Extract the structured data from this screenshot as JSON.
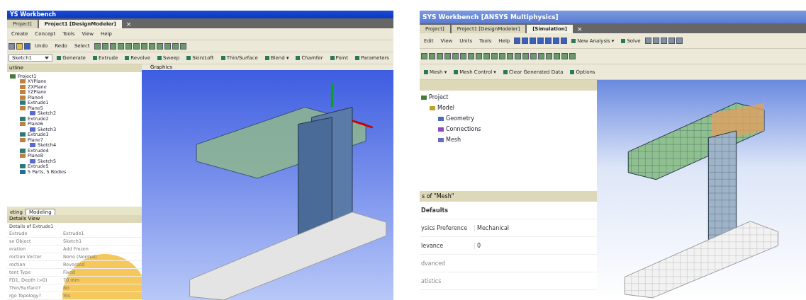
{
  "left_window": {
    "title": "YS Workbench",
    "tabs": [
      {
        "label": "Project]",
        "selected": false
      },
      {
        "label": "Project1 [DesignModeler]",
        "selected": true
      }
    ],
    "tab_close": "×",
    "menu": [
      "Create",
      "Concept",
      "Tools",
      "View",
      "Help"
    ],
    "toolbar": [
      "Undo",
      "Redo",
      "Select"
    ],
    "feature_bar": {
      "sketch_select": "Sketch1",
      "items": [
        "Generate",
        "Extrude",
        "Revolve",
        "Sweep",
        "Skin/Loft",
        "Thin/Surface",
        "Blend ▾",
        "Chamfer",
        "Point",
        "Parameters"
      ]
    },
    "outline": {
      "header": "utline",
      "tree": [
        {
          "label": "Project1",
          "kind": "root",
          "children": [
            {
              "label": "XYPlane",
              "kind": "plane"
            },
            {
              "label": "ZXPlane",
              "kind": "plane"
            },
            {
              "label": "YZPlane",
              "kind": "plane"
            },
            {
              "label": "Plane4",
              "kind": "plane"
            },
            {
              "label": "Extrude1",
              "kind": "extrude"
            },
            {
              "label": "Plane5",
              "kind": "plane",
              "children": [
                {
                  "label": "Sketch2",
                  "kind": "sketch"
                }
              ]
            },
            {
              "label": "Extrude2",
              "kind": "extrude"
            },
            {
              "label": "Plane6",
              "kind": "plane",
              "children": [
                {
                  "label": "Sketch3",
                  "kind": "sketch"
                }
              ]
            },
            {
              "label": "Extrude3",
              "kind": "extrude"
            },
            {
              "label": "Plane7",
              "kind": "plane",
              "children": [
                {
                  "label": "Sketch4",
                  "kind": "sketch"
                }
              ]
            },
            {
              "label": "Extrude4",
              "kind": "extrude"
            },
            {
              "label": "Plane8",
              "kind": "plane",
              "children": [
                {
                  "label": "Sketch5",
                  "kind": "sketch"
                }
              ]
            },
            {
              "label": "Extrude5",
              "kind": "extrude"
            },
            {
              "label": "5 Parts, 5 Bodies",
              "kind": "parts"
            }
          ]
        }
      ]
    },
    "graphics_header": "Graphics",
    "bottom_tabs": [
      {
        "label": "eting",
        "selected": false
      },
      {
        "label": "Modeling",
        "selected": true
      }
    ],
    "details": {
      "header": "Details View",
      "title": "Details of Extrude1",
      "rows": [
        {
          "name": "Extrude",
          "value": "Extrude1"
        },
        {
          "name": "se Object",
          "value": "Sketch1"
        },
        {
          "name": "eration",
          "value": "Add Frozen"
        },
        {
          "name": "rection Vector",
          "value": "None (Normal)"
        },
        {
          "name": "rection",
          "value": "Reversed"
        },
        {
          "name": "tent Type",
          "value": "Fixed"
        },
        {
          "name": "FD1, Depth (>0)",
          "value": "70 mm"
        },
        {
          "name": "Thin/Surface?",
          "value": "No"
        },
        {
          "name": "rge Topology?",
          "value": "Yes"
        }
      ]
    }
  },
  "right_window": {
    "title": "SYS Workbench [ANSYS Multiphysics]",
    "tabs": [
      {
        "label": "Project]",
        "selected": false
      },
      {
        "label": "Project1 [DesignModeler]",
        "selected": false
      },
      {
        "label": "[Simulation]",
        "selected": true
      }
    ],
    "tab_close": "×",
    "menu": [
      "Edit",
      "View",
      "Units",
      "Tools",
      "Help"
    ],
    "toolbar": [
      "New Analysis ▾",
      "Solve"
    ],
    "mesh_bar": [
      "Mesh ▾",
      "Mesh Control ▾",
      "Clear Generated Data",
      "Options"
    ],
    "tree": [
      {
        "label": "Project",
        "kind": "root",
        "children": [
          {
            "label": "Model",
            "kind": "model",
            "children": [
              {
                "label": "Geometry",
                "kind": "geometry"
              },
              {
                "label": "Connections",
                "kind": "connections"
              },
              {
                "label": "Mesh",
                "kind": "mesh"
              }
            ]
          }
        ]
      }
    ],
    "details": {
      "header": "s of \"Mesh\"",
      "rows": [
        {
          "name": "Defaults",
          "kind": "group"
        },
        {
          "name": "ysics Preference",
          "value": "Mechanical",
          "kind": "row"
        },
        {
          "name": "levance",
          "value": "0",
          "kind": "row"
        },
        {
          "name": "dvanced",
          "kind": "group-light"
        },
        {
          "name": "atistics",
          "kind": "group-light"
        }
      ]
    }
  }
}
